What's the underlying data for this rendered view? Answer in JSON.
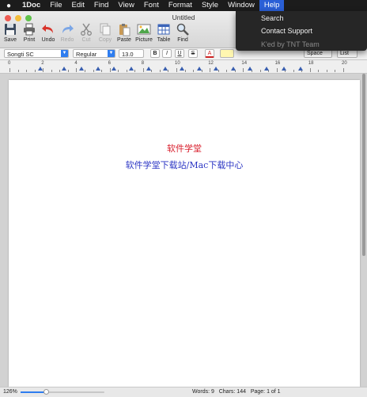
{
  "menubar": {
    "app_name": "1Doc",
    "items": [
      "File",
      "Edit",
      "Find",
      "View",
      "Font",
      "Format",
      "Style",
      "Window"
    ],
    "active_item": "Help"
  },
  "window": {
    "title": "Untitled"
  },
  "toolbar": {
    "save": "Save",
    "print": "Print",
    "undo": "Undo",
    "redo": "Redo",
    "cut": "Cut",
    "copy": "Copy",
    "paste": "Paste",
    "picture": "Picture",
    "table": "Table",
    "find": "Find"
  },
  "formatbar": {
    "font_family": "Songti SC",
    "font_style": "Regular",
    "font_size": "13.0",
    "bold": "B",
    "italic": "I",
    "underline": "U",
    "strikethrough": "S",
    "text_color_glyph": "A",
    "spacing": "Space",
    "list": "List"
  },
  "ruler": {
    "numbers": [
      "0",
      "2",
      "4",
      "6",
      "8",
      "10",
      "12",
      "14",
      "16",
      "18",
      "20"
    ]
  },
  "document": {
    "line1": "软件学堂",
    "line2": "软件学堂下载站/Mac下载中心",
    "line1_color": "#d81c2a",
    "line2_color": "#2b35c4"
  },
  "statusbar": {
    "zoom": "126%",
    "zoom_level": 0.3,
    "words": "Words: 9",
    "chars": "Chars: 144",
    "page": "Page: 1 of 1"
  },
  "help_menu": {
    "items": [
      "Search",
      "Contact Support",
      "K'ed by TNT Team"
    ]
  },
  "colors": {
    "accent": "#2e7df0",
    "menu_highlight": "#2a5fd6"
  }
}
